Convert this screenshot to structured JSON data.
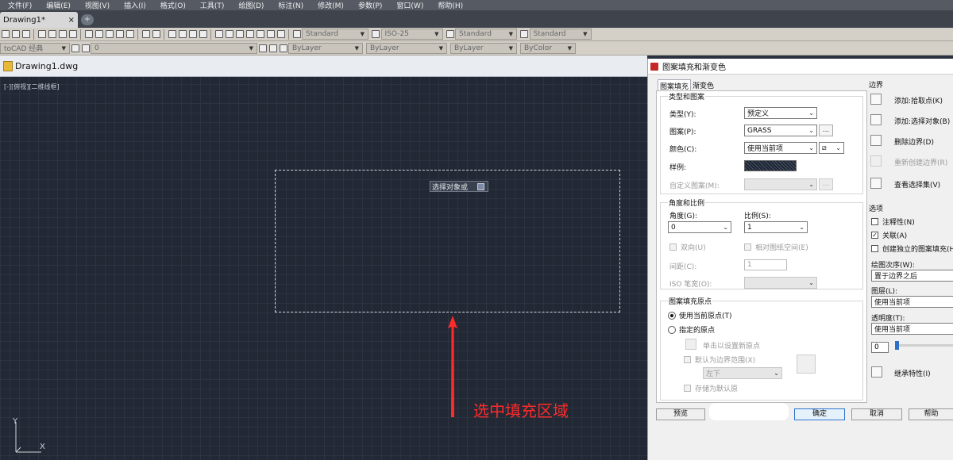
{
  "menubar": {
    "items": [
      "文件(F)",
      "编辑(E)",
      "视图(V)",
      "插入(I)",
      "格式(O)",
      "工具(T)",
      "绘图(D)",
      "标注(N)",
      "修改(M)",
      "参数(P)",
      "窗口(W)",
      "帮助(H)"
    ]
  },
  "tabbar": {
    "doc_tab": "Drawing1*",
    "close_glyph": "×",
    "new_tab_glyph": "+"
  },
  "toolbar1": {
    "text_style": "Standard",
    "dim_style": "ISO-25",
    "table_style": "Standard",
    "mleader_style": "Standard"
  },
  "toolbar2": {
    "workspace": "toCAD 经典",
    "layer": "0",
    "color": "ByLayer",
    "linetype": "ByLayer",
    "lineweight": "ByLayer",
    "plotstyle": "ByColor"
  },
  "drawing": {
    "title": "Drawing1.dwg",
    "viewport_label": "[-][俯视][二维线框]",
    "tooltip": "选择对象或",
    "annotation": "选中填充区域",
    "ucs_y": "Y",
    "ucs_x": "X"
  },
  "dialog": {
    "title": "图案填充和渐变色",
    "tab_hatch": "图案填充",
    "tab_gradient": "渐变色",
    "type_group": "类型和图案",
    "type_label": "类型(Y):",
    "type_value": "预定义",
    "pattern_label": "图案(P):",
    "pattern_value": "GRASS",
    "color_label": "颜色(C):",
    "color_value": "使用当前项",
    "sample_label": "样例:",
    "custom_pattern_label": "自定义图案(M):",
    "ellipsis": "...",
    "angle_group": "角度和比例",
    "angle_label": "角度(G):",
    "angle_value": "0",
    "scale_label": "比例(S):",
    "scale_value": "1",
    "double_label": "双向(U)",
    "relative_label": "相对图纸空间(E)",
    "spacing_label": "间距(C):",
    "spacing_value": "1",
    "iso_label": "ISO 笔宽(O):",
    "origin_group": "图案填充原点",
    "use_current_origin": "使用当前原点(T)",
    "specified_origin": "指定的原点",
    "click_set_origin": "单击以设置新原点",
    "default_extents": "默认为边界范围(X)",
    "extents_value": "左下",
    "store_default": "存储为默认原",
    "boundary_group": "边界",
    "add_pick": "添加:拾取点(K)",
    "add_select": "添加:选择对象(B)",
    "remove_boundary": "删除边界(D)",
    "recreate_boundary": "重新创建边界(R)",
    "view_selection": "查看选择集(V)",
    "options_group": "选项",
    "annotative": "注释性(N)",
    "associative": "关联(A)",
    "separate_hatches": "创建独立的图案填充(H)",
    "draw_order_label": "绘图次序(W):",
    "draw_order_value": "置于边界之后",
    "layer_label": "图层(L):",
    "layer_value": "使用当前项",
    "transparency_label": "透明度(T):",
    "transparency_value": "使用当前项",
    "transparency_number": "0",
    "inherit": "继承特性(I)",
    "preview": "预览",
    "ok": "确定",
    "cancel": "取消",
    "help": "帮助"
  }
}
